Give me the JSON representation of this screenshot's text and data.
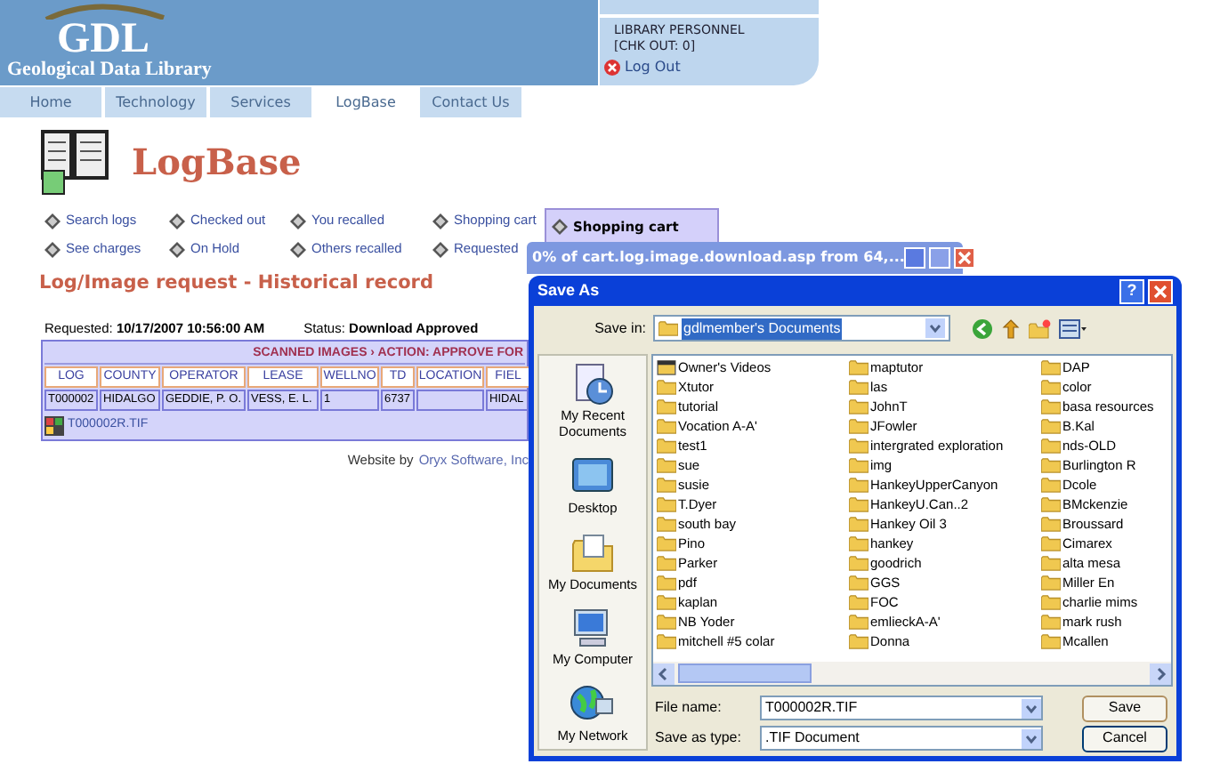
{
  "header": {
    "logo": {
      "initials": "GDL",
      "name": "Geological Data Library"
    },
    "user_panel": {
      "role": "LIBRARY PERSONNEL",
      "checkout": "[CHK OUT: 0]",
      "logout": "Log Out"
    }
  },
  "tabs": [
    {
      "label": "Home",
      "selected": false
    },
    {
      "label": "Technology",
      "selected": false
    },
    {
      "label": "Services",
      "selected": false
    },
    {
      "label": "LogBase",
      "selected": true
    },
    {
      "label": "Contact Us",
      "selected": false
    }
  ],
  "app_title": "LogBase",
  "links": [
    "Search logs",
    "Checked out",
    "You recalled",
    "Shopping cart",
    "See charges",
    "On Hold",
    "Others recalled",
    "Requested"
  ],
  "cart_popup": "Shopping cart",
  "page_title": "Log/Image request - Historical record",
  "request": {
    "requested_label": "Requested:",
    "requested_value": "10/17/2007 10:56:00 AM",
    "status_label": "Status:",
    "status_value": "Download Approved"
  },
  "table": {
    "banner": "SCANNED IMAGES › ACTION: APPROVE FOR",
    "columns": [
      "LOG",
      "COUNTY",
      "OPERATOR",
      "LEASE",
      "WELLNO",
      "TD",
      "LOCATION",
      "FIEL"
    ],
    "rows": [
      [
        "T000002",
        "HIDALGO",
        "GEDDIE, P. O.",
        "VESS, E. L.",
        "1",
        "6737",
        null,
        "HIDAL"
      ]
    ],
    "file": "T000002R.TIF"
  },
  "footer": {
    "text": "Website by",
    "link": "Oryx Software, Inc"
  },
  "download_window": {
    "title": "0% of cart.log.image.download.asp from 64,..."
  },
  "save_dialog": {
    "title": "Save As",
    "help": "?",
    "save_in_label": "Save in:",
    "save_in_value": "gdlmember's Documents",
    "places": [
      {
        "label": "My Recent Documents",
        "kind": "recent"
      },
      {
        "label": "Desktop",
        "kind": "desktop"
      },
      {
        "label": "My Documents",
        "kind": "documents"
      },
      {
        "label": "My Computer",
        "kind": "computer"
      },
      {
        "label": "My Network",
        "kind": "network"
      }
    ],
    "files": [
      {
        "name": "Owner's Videos",
        "kind": "video"
      },
      {
        "name": "Xtutor",
        "kind": "folder"
      },
      {
        "name": "tutorial",
        "kind": "folder"
      },
      {
        "name": "Vocation A-A'",
        "kind": "folder"
      },
      {
        "name": "test1",
        "kind": "folder"
      },
      {
        "name": "sue",
        "kind": "folder"
      },
      {
        "name": "susie",
        "kind": "folder"
      },
      {
        "name": "T.Dyer",
        "kind": "folder"
      },
      {
        "name": "south bay",
        "kind": "folder"
      },
      {
        "name": "Pino",
        "kind": "folder"
      },
      {
        "name": "Parker",
        "kind": "folder"
      },
      {
        "name": "pdf",
        "kind": "folder"
      },
      {
        "name": "kaplan",
        "kind": "folder"
      },
      {
        "name": "NB Yoder",
        "kind": "folder"
      },
      {
        "name": "mitchell #5 colar",
        "kind": "folder"
      },
      {
        "name": "maptutor",
        "kind": "folder"
      },
      {
        "name": "las",
        "kind": "folder"
      },
      {
        "name": "JohnT",
        "kind": "folder"
      },
      {
        "name": "JFowler",
        "kind": "folder"
      },
      {
        "name": "intergrated exploration",
        "kind": "folder"
      },
      {
        "name": "img",
        "kind": "folder"
      },
      {
        "name": "HankeyUpperCanyon",
        "kind": "folder"
      },
      {
        "name": "HankeyU.Can..2",
        "kind": "folder"
      },
      {
        "name": "Hankey Oil 3",
        "kind": "folder"
      },
      {
        "name": "hankey",
        "kind": "folder"
      },
      {
        "name": "goodrich",
        "kind": "folder"
      },
      {
        "name": "GGS",
        "kind": "folder"
      },
      {
        "name": "FOC",
        "kind": "folder"
      },
      {
        "name": "emlieckA-A'",
        "kind": "folder"
      },
      {
        "name": "Donna",
        "kind": "folder"
      },
      {
        "name": "DAP",
        "kind": "folder"
      },
      {
        "name": "color",
        "kind": "folder"
      },
      {
        "name": "basa resources",
        "kind": "folder"
      },
      {
        "name": "B.Kal",
        "kind": "folder"
      },
      {
        "name": "nds-OLD",
        "kind": "folder"
      },
      {
        "name": "Burlington R",
        "kind": "folder"
      },
      {
        "name": "Dcole",
        "kind": "folder"
      },
      {
        "name": "BMckenzie",
        "kind": "folder"
      },
      {
        "name": "Broussard",
        "kind": "folder"
      },
      {
        "name": "Cimarex",
        "kind": "folder"
      },
      {
        "name": "alta mesa",
        "kind": "folder"
      },
      {
        "name": "Miller En",
        "kind": "folder"
      },
      {
        "name": "charlie mims",
        "kind": "folder"
      },
      {
        "name": "mark rush",
        "kind": "folder"
      },
      {
        "name": "Mcallen",
        "kind": "folder"
      }
    ],
    "file_name_label": "File name:",
    "file_name_value": "T000002R.TIF",
    "type_label": "Save as type:",
    "type_value": ".TIF Document",
    "buttons": [
      "Save",
      "Cancel"
    ]
  }
}
